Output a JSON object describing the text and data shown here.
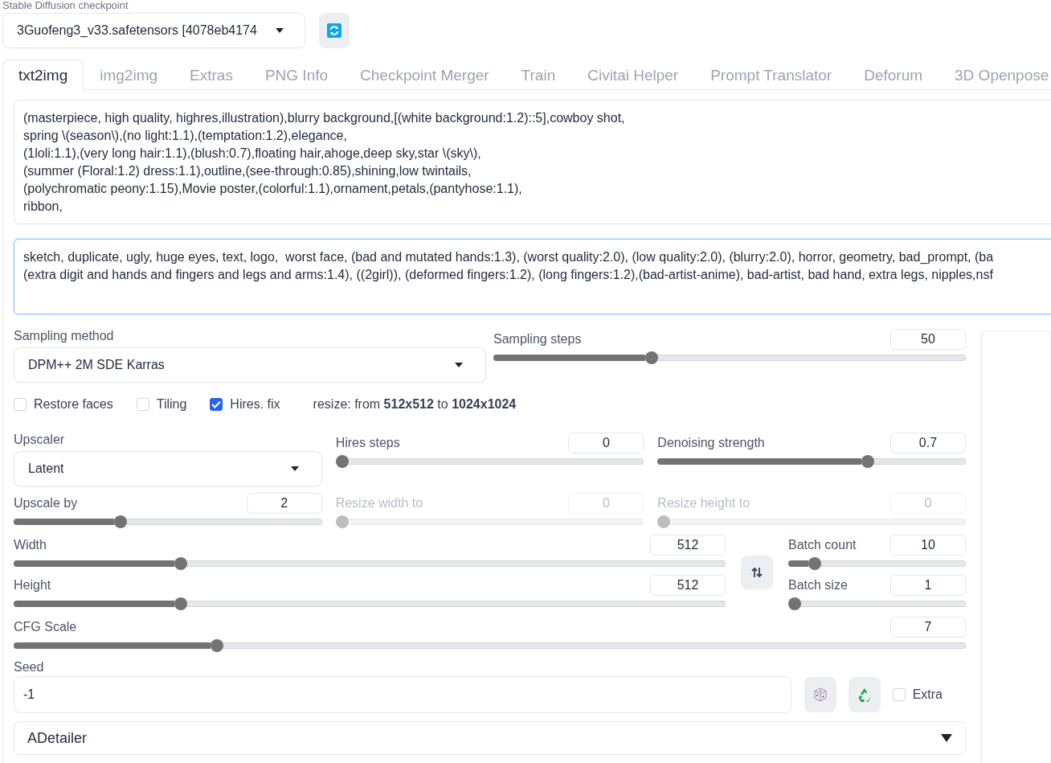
{
  "checkpoint": {
    "label": "Stable Diffusion checkpoint",
    "value": "3Guofeng3_v33.safetensors [4078eb4174"
  },
  "tabs": [
    {
      "label": "txt2img",
      "selected": true
    },
    {
      "label": "img2img",
      "selected": false
    },
    {
      "label": "Extras",
      "selected": false
    },
    {
      "label": "PNG Info",
      "selected": false
    },
    {
      "label": "Checkpoint Merger",
      "selected": false
    },
    {
      "label": "Train",
      "selected": false
    },
    {
      "label": "Civitai Helper",
      "selected": false
    },
    {
      "label": "Prompt Translator",
      "selected": false
    },
    {
      "label": "Deforum",
      "selected": false
    },
    {
      "label": "3D Openpose",
      "selected": false
    }
  ],
  "prompt": "(masterpiece, high quality, highres,illustration),blurry background,[(white background:1.2)::5],cowboy shot,\nspring \\(season\\),(no light:1.1),(temptation:1.2),elegance,\n(1loli:1.1),(very long hair:1.1),(blush:0.7),floating hair,ahoge,deep sky,star \\(sky\\),\n(summer (Floral:1.2) dress:1.1),outline,(see-through:0.85),shining,low twintails,\n(polychromatic peony:1.15),Movie poster,(colorful:1.1),ornament,petals,(pantyhose:1.1),\nribbon,",
  "negative_prompt": "sketch, duplicate, ugly, huge eyes, text, logo,  worst face, (bad and mutated hands:1.3), (worst quality:2.0), (low quality:2.0), (blurry:2.0), horror, geometry, bad_prompt, (ba\n(extra digit and hands and fingers and legs and arms:1.4), ((2girl)), (deformed fingers:1.2), (long fingers:1.2),(bad-artist-anime), bad-artist, bad hand, extra legs, nipples,nsf",
  "sampling_method": {
    "label": "Sampling method",
    "value": "DPM++ 2M SDE Karras"
  },
  "sampling_steps": {
    "label": "Sampling steps",
    "value": "50",
    "level": 0.33,
    "disabled": false
  },
  "options": [
    {
      "label": "Restore faces",
      "checked": false
    },
    {
      "label": "Tiling",
      "checked": false
    },
    {
      "label": "Hires. fix",
      "checked": true
    }
  ],
  "resize_info": "resize: from **512x512** to **1024x1024**",
  "hires_controls": [
    {
      "kind": "dropdown",
      "label": "Upscaler",
      "value": "Latent"
    },
    {
      "kind": "slider",
      "label": "Hires steps",
      "value": "0",
      "level": 0,
      "disabled": false
    },
    {
      "kind": "slider",
      "label": "Denoising strength",
      "value": "0.7",
      "level": 0.69,
      "disabled": false
    },
    {
      "kind": "slider",
      "label": "Upscale by",
      "value": "2",
      "level": 0.34,
      "disabled": false
    },
    {
      "kind": "slider",
      "label": "Resize width to",
      "value": "0",
      "level": 0,
      "disabled": true
    },
    {
      "kind": "slider",
      "label": "Resize height to",
      "value": "0",
      "level": 0,
      "disabled": true
    }
  ],
  "size_sliders": [
    {
      "label": "Width",
      "value": "512",
      "level": 0.23,
      "disabled": false
    },
    {
      "label": "Height",
      "value": "512",
      "level": 0.23,
      "disabled": false
    }
  ],
  "batch_sliders": [
    {
      "label": "Batch count",
      "value": "10",
      "level": 0.12,
      "disabled": false
    },
    {
      "label": "Batch size",
      "value": "1",
      "level": 0,
      "disabled": false
    }
  ],
  "cfg_scale": {
    "label": "CFG Scale",
    "value": "7",
    "level": 0.21,
    "disabled": false
  },
  "seed": {
    "label": "Seed",
    "value": "-1"
  },
  "extra": {
    "label": "Extra",
    "checked": false
  },
  "adetailer": {
    "label": "ADetailer"
  }
}
